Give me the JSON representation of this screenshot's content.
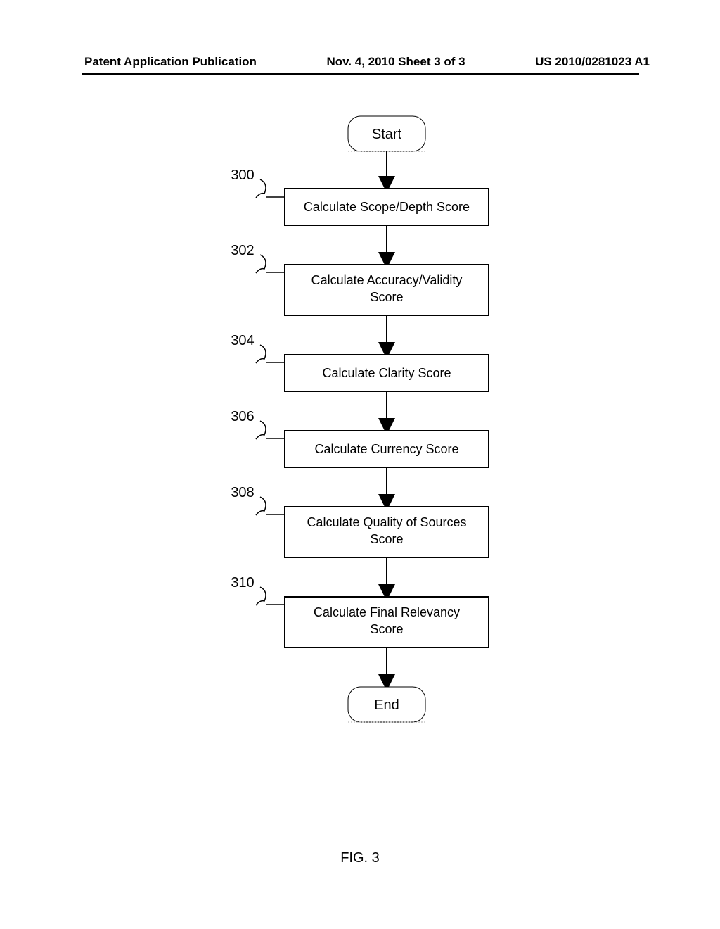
{
  "header": {
    "left": "Patent Application Publication",
    "center": "Nov. 4, 2010  Sheet 3 of 3",
    "right": "US 2010/0281023 A1"
  },
  "figure_label": "FIG. 3",
  "flow": {
    "start": "Start",
    "end": "End",
    "steps": [
      {
        "ref": "300",
        "text": "Calculate Scope/Depth Score"
      },
      {
        "ref": "302",
        "text": "Calculate Accuracy/Validity Score"
      },
      {
        "ref": "304",
        "text": "Calculate Clarity Score"
      },
      {
        "ref": "306",
        "text": "Calculate Currency Score"
      },
      {
        "ref": "308",
        "text": "Calculate Quality of Sources Score"
      },
      {
        "ref": "310",
        "text": "Calculate Final Relevancy Score"
      }
    ]
  },
  "chart_data": {
    "type": "flowchart",
    "title": "FIG. 3",
    "nodes": [
      {
        "id": "start",
        "shape": "terminator",
        "label": "Start"
      },
      {
        "id": "300",
        "shape": "process",
        "label": "Calculate Scope/Depth Score"
      },
      {
        "id": "302",
        "shape": "process",
        "label": "Calculate Accuracy/Validity Score"
      },
      {
        "id": "304",
        "shape": "process",
        "label": "Calculate Clarity Score"
      },
      {
        "id": "306",
        "shape": "process",
        "label": "Calculate Currency Score"
      },
      {
        "id": "308",
        "shape": "process",
        "label": "Calculate Quality of Sources Score"
      },
      {
        "id": "310",
        "shape": "process",
        "label": "Calculate Final Relevancy Score"
      },
      {
        "id": "end",
        "shape": "terminator",
        "label": "End"
      }
    ],
    "edges": [
      [
        "start",
        "300"
      ],
      [
        "300",
        "302"
      ],
      [
        "302",
        "304"
      ],
      [
        "304",
        "306"
      ],
      [
        "306",
        "308"
      ],
      [
        "308",
        "310"
      ],
      [
        "310",
        "end"
      ]
    ]
  }
}
